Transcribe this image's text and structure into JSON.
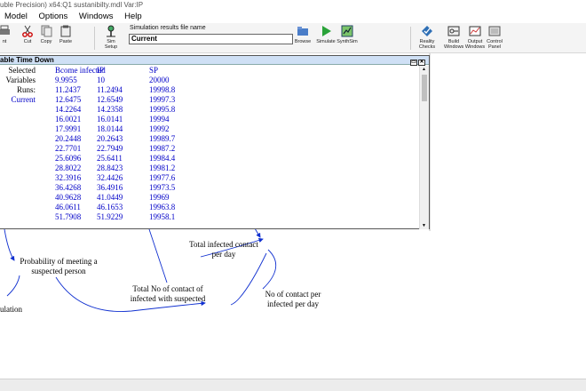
{
  "window_title": "uble Precision) x64:Q1 sustanibilty.mdl Var:IP",
  "menu": [
    "Model",
    "Options",
    "Windows",
    "Help"
  ],
  "toolbar": {
    "cut": "Cut",
    "copy": "Copy",
    "paste": "Paste",
    "sim_setup": "Sim Setup",
    "sim_file_label": "Simulation results file name",
    "sim_file_value": "Current",
    "browse": "Browse",
    "simulate": "Simulate",
    "synthesim": "SynthSim",
    "reality_checks": "Reality Checks",
    "build_windows": "Build Windows",
    "output_windows": "Output Windows",
    "control_panel": "Control Panel",
    "left_partial": "nt"
  },
  "table_window": {
    "title": "able Time Down",
    "header_labels": [
      "Selected",
      "Variables",
      "Runs:",
      "Current"
    ],
    "columns": [
      {
        "header": "Bcome infected",
        "values": [
          "9.9955",
          "11.2437",
          "12.6475",
          "14.2264",
          "16.0021",
          "17.9991",
          "20.2448",
          "22.7701",
          "25.6096",
          "28.8022",
          "32.3916",
          "36.4268",
          "40.9628",
          "46.0611",
          "51.7908"
        ]
      },
      {
        "header": "IP",
        "values": [
          "10",
          "11.2494",
          "12.6549",
          "14.2358",
          "16.0141",
          "18.0144",
          "20.2643",
          "22.7949",
          "25.6411",
          "28.8423",
          "32.4426",
          "36.4916",
          "41.0449",
          "46.1653",
          "51.9229"
        ]
      },
      {
        "header": "SP",
        "values": [
          "20000",
          "19998.8",
          "19997.3",
          "19995.8",
          "19994",
          "19992",
          "19989.7",
          "19987.2",
          "19984.4",
          "19981.2",
          "19977.6",
          "19973.5",
          "19969",
          "19963.8",
          "19958.1"
        ]
      }
    ]
  },
  "diagram": {
    "prob_meeting": "Probability of meeting a suspected person",
    "total_infected_contact": "Total infected contact per day",
    "total_no_contact": "Total No of contact of infected with suspected",
    "no_contact_per_infected": "No of contact per infected per day",
    "population_partial": "ulation"
  }
}
